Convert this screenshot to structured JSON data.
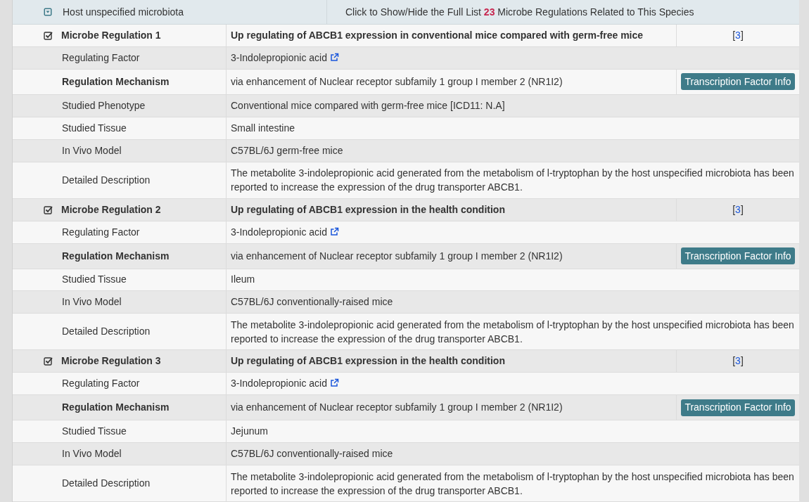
{
  "species_header": {
    "name": "Host unspecified microbiota",
    "toggle_text": {
      "before": "Click to Show/Hide the Full List",
      "count": "23",
      "after": "Microbe Regulations Related to This Species"
    }
  },
  "regulations": [
    {
      "title": "Microbe Regulation 1",
      "summary": "Up regulating of ABCB1 expression in conventional mice compared with germ-free mice",
      "reference": {
        "open": "[",
        "number": "3",
        "close": "]"
      },
      "fields": [
        {
          "kind": "link",
          "label": "Regulating Factor",
          "value": "3-Indolepropionic acid"
        },
        {
          "kind": "button",
          "label": "Regulation Mechanism",
          "value": "via enhancement of Nuclear receptor subfamily 1 group I member 2 (NR1I2)",
          "button": "Transcription Factor Info"
        },
        {
          "kind": "text",
          "label": "Studied Phenotype",
          "value": "Conventional mice compared with germ-free mice [ICD11: N.A]"
        },
        {
          "kind": "text",
          "label": "Studied Tissue",
          "value": "Small intestine"
        },
        {
          "kind": "text",
          "label": "In Vivo Model",
          "value": "C57BL/6J germ-free mice"
        },
        {
          "kind": "long",
          "label": "Detailed Description",
          "value": "The metabolite 3-indolepropionic acid generated from the metabolism of l-tryptophan by the host unspecified microbiota has been reported to increase the expression of the drug transporter ABCB1."
        }
      ]
    },
    {
      "title": "Microbe Regulation 2",
      "summary": "Up regulating of ABCB1 expression in the health condition",
      "reference": {
        "open": "[",
        "number": "3",
        "close": "]"
      },
      "fields": [
        {
          "kind": "link",
          "label": "Regulating Factor",
          "value": "3-Indolepropionic acid"
        },
        {
          "kind": "button",
          "label": "Regulation Mechanism",
          "value": "via enhancement of Nuclear receptor subfamily 1 group I member 2 (NR1I2)",
          "button": "Transcription Factor Info"
        },
        {
          "kind": "text",
          "label": "Studied Tissue",
          "value": "Ileum"
        },
        {
          "kind": "text",
          "label": "In Vivo Model",
          "value": "C57BL/6J conventionally-raised mice"
        },
        {
          "kind": "long",
          "label": "Detailed Description",
          "value": "The metabolite 3-indolepropionic acid generated from the metabolism of l-tryptophan by the host unspecified microbiota has been reported to increase the expression of the drug transporter ABCB1."
        }
      ]
    },
    {
      "title": "Microbe Regulation 3",
      "summary": "Up regulating of ABCB1 expression in the health condition",
      "reference": {
        "open": "[",
        "number": "3",
        "close": "]"
      },
      "fields": [
        {
          "kind": "link",
          "label": "Regulating Factor",
          "value": "3-Indolepropionic acid"
        },
        {
          "kind": "button",
          "label": "Regulation Mechanism",
          "value": "via enhancement of Nuclear receptor subfamily 1 group I member 2 (NR1I2)",
          "button": "Transcription Factor Info"
        },
        {
          "kind": "text",
          "label": "Studied Tissue",
          "value": "Jejunum"
        },
        {
          "kind": "text",
          "label": "In Vivo Model",
          "value": "C57BL/6J conventionally-raised mice"
        },
        {
          "kind": "long",
          "label": "Detailed Description",
          "value": "The metabolite 3-indolepropionic acid generated from the metabolism of l-tryptophan by the host unspecified microbiota has been reported to increase the expression of the drug transporter ABCB1."
        }
      ]
    }
  ]
}
